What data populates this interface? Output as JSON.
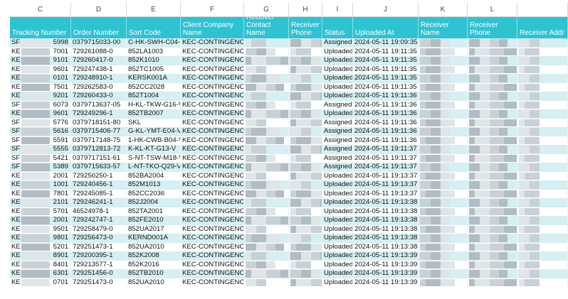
{
  "column_letters": [
    "C",
    "D",
    "E",
    "F",
    "G",
    "H",
    "I",
    "J",
    "K",
    "L",
    ""
  ],
  "headers": [
    "Tracking Number",
    "Order Number",
    "Sort Code",
    "Client Company Name",
    "Receiver Contact Name",
    "Receiver Phone",
    "Status",
    "Uploaded At",
    "Receiver Name",
    "Receiver Phone",
    "Receiver Addr"
  ],
  "rows": [
    {
      "tn_prefix": "SF",
      "tn_suffix": "5998",
      "order": "0379715033-00",
      "sort": "C-HK-SWH-C04-V",
      "client": "KEC-CONTINGENCY",
      "status": "Assigned",
      "uploaded": "2024-05-11 19:09:35"
    },
    {
      "tn_prefix": "KE",
      "tn_suffix": "7001",
      "order": "729261088-0",
      "sort": "852LA1003",
      "client": "KEC-CONTINGENCY",
      "status": "Uploaded",
      "uploaded": "2024-05-11 19:11:35"
    },
    {
      "tn_prefix": "KE",
      "tn_suffix": "9101",
      "order": "729260417-0",
      "sort": "852K1010",
      "client": "KEC-CONTINGENCY",
      "status": "Uploaded",
      "uploaded": "2024-05-11 19:11:35"
    },
    {
      "tn_prefix": "KE",
      "tn_suffix": "9601",
      "order": "729247438-1",
      "sort": "852TC1005",
      "client": "KEC-CONTINGENCY",
      "status": "Uploaded",
      "uploaded": "2024-05-11 19:11:35"
    },
    {
      "tn_prefix": "KE",
      "tn_suffix": "0101",
      "order": "729248910-1",
      "sort": "KERSK001A",
      "client": "KEC-CONTINGENCY",
      "status": "Uploaded",
      "uploaded": "2024-05-11 19:11:35"
    },
    {
      "tn_prefix": "KE",
      "tn_suffix": "7501",
      "order": "729262583-0",
      "sort": "852CC2028",
      "client": "KEC-CONTINGENCY",
      "status": "Uploaded",
      "uploaded": "2024-05-11 19:11:35"
    },
    {
      "tn_prefix": "KE",
      "tn_suffix": "9201",
      "order": "729260433-0",
      "sort": "852T1004",
      "client": "KEC-CONTINGENCY",
      "status": "Uploaded",
      "uploaded": "2024-05-11 19:11:36"
    },
    {
      "tn_prefix": "SF",
      "tn_suffix": "6073",
      "order": "0379713637-05",
      "sort": "H-KL-TKW-G16-V",
      "client": "KEC-CONTINGENCY",
      "status": "Assigned",
      "uploaded": "2024-05-11 19:11:36"
    },
    {
      "tn_prefix": "KE",
      "tn_suffix": "9601",
      "order": "729249296-1",
      "sort": "852TB2007",
      "client": "KEC-CONTINGENCY",
      "status": "Uploaded",
      "uploaded": "2024-05-11 19:11:36"
    },
    {
      "tn_prefix": "SF",
      "tn_suffix": "5776",
      "order": "0379718151-80",
      "sort": "SKL",
      "client": "KEC-CONTINGENCY",
      "status": "Assigned",
      "uploaded": "2024-05-11 19:11:36"
    },
    {
      "tn_prefix": "SF",
      "tn_suffix": "5616",
      "order": "0379715406-77",
      "sort": "G-KL-YMT-E04-V",
      "client": "KEC-CONTINGENCY",
      "status": "Assigned",
      "uploaded": "2024-05-11 19:11:36"
    },
    {
      "tn_prefix": "SF",
      "tn_suffix": "5591",
      "order": "0379717148-75",
      "sort": "1-HK-CWB-B04-V",
      "client": "KEC-CONTINGENCY",
      "status": "Assigned",
      "uploaded": "2024-05-11 19:11:36"
    },
    {
      "tn_prefix": "SF",
      "tn_suffix": "5555",
      "order": "0379712813-72",
      "sort": "K-KL-KT-G13-V",
      "client": "KEC-CONTINGENCY",
      "status": "Assigned",
      "uploaded": "2024-05-11 19:11:37"
    },
    {
      "tn_prefix": "SF",
      "tn_suffix": "5421",
      "order": "0379717151-61",
      "sort": "S-NT-TSW-M18-V",
      "client": "KEC-CONTINGENCY",
      "status": "Assigned",
      "uploaded": "2024-05-11 19:11:37"
    },
    {
      "tn_prefix": "SF",
      "tn_suffix": "5389",
      "order": "0379715633-57",
      "sort": "L-NT-TKO-Q29-V",
      "client": "KEC-CONTINGENCY",
      "status": "Assigned",
      "uploaded": "2024-05-11 19:11:37"
    },
    {
      "tn_prefix": "KE",
      "tn_suffix": "2001",
      "order": "729250250-1",
      "sort": "852BA2004",
      "client": "KEC-CONTINGENCY",
      "status": "Uploaded",
      "uploaded": "2024-05-11 19:13:37"
    },
    {
      "tn_prefix": "KE",
      "tn_suffix": "1001",
      "order": "729240456-1",
      "sort": "852M1013",
      "client": "KEC-CONTINGENCY",
      "status": "Uploaded",
      "uploaded": "2024-05-11 19:13:37"
    },
    {
      "tn_prefix": "KE",
      "tn_suffix": "7801",
      "order": "729245085-1",
      "sort": "852CC2036",
      "client": "KEC-CONTINGENCY",
      "status": "Uploaded",
      "uploaded": "2024-05-11 19:13:37"
    },
    {
      "tn_prefix": "KE",
      "tn_suffix": "2101",
      "order": "729246241-1",
      "sort": "852J2004",
      "client": "KEC-CONTINGENCY",
      "status": "Uploaded",
      "uploaded": "2024-05-11 19:13:38"
    },
    {
      "tn_prefix": "KE",
      "tn_suffix": "5701",
      "order": "46524978-1",
      "sort": "852TA2001",
      "client": "KEC-CONTINGENCY",
      "status": "Uploaded",
      "uploaded": "2024-05-11 19:13:38"
    },
    {
      "tn_prefix": "KE",
      "tn_suffix": "2001",
      "order": "729242747-1",
      "sort": "852FE2010",
      "client": "KEC-CONTINGENCY",
      "status": "Uploaded",
      "uploaded": "2024-05-11 19:13:38"
    },
    {
      "tn_prefix": "KE",
      "tn_suffix": "9501",
      "order": "729258479-0",
      "sort": "852UA2017",
      "client": "KEC-CONTINGENCY",
      "status": "Uploaded",
      "uploaded": "2024-05-11 19:13:38"
    },
    {
      "tn_prefix": "KE",
      "tn_suffix": "9801",
      "order": "729256473-0",
      "sort": "KERND001A",
      "client": "KEC-CONTINGENCY",
      "status": "Uploaded",
      "uploaded": "2024-05-11 19:13:38"
    },
    {
      "tn_prefix": "KE",
      "tn_suffix": "5201",
      "order": "729251473-1",
      "sort": "852UA2010",
      "client": "KEC-CONTINGENCY",
      "status": "Uploaded",
      "uploaded": "2024-05-11 19:13:38"
    },
    {
      "tn_prefix": "KE",
      "tn_suffix": "8901",
      "order": "729200395-1",
      "sort": "852K2008",
      "client": "KEC-CONTINGENCY",
      "status": "Uploaded",
      "uploaded": "2024-05-11 19:13:39"
    },
    {
      "tn_prefix": "KE",
      "tn_suffix": "8401",
      "order": "729213577-1",
      "sort": "852K2016",
      "client": "KEC-CONTINGENCY",
      "status": "Uploaded",
      "uploaded": "2024-05-11 19:13:39"
    },
    {
      "tn_prefix": "KE",
      "tn_suffix": "6301",
      "order": "729251456-0",
      "sort": "852TB2010",
      "client": "KEC-CONTINGENCY",
      "status": "Uploaded",
      "uploaded": "2024-05-11 19:13:39"
    },
    {
      "tn_prefix": "KE",
      "tn_suffix": "0701",
      "order": "729251473-0",
      "sort": "852UA2010",
      "client": "KEC-CONTINGENCY",
      "status": "Uploaded",
      "uploaded": "2024-05-11 19:13:39"
    }
  ],
  "colors": {
    "header_bg": "#2ec3d2",
    "row_alt": "#d5eff2",
    "blur_light": "#dfe5e8",
    "blur_mid": "#c9d1d6",
    "blur_dark": "#b3bcc2"
  }
}
